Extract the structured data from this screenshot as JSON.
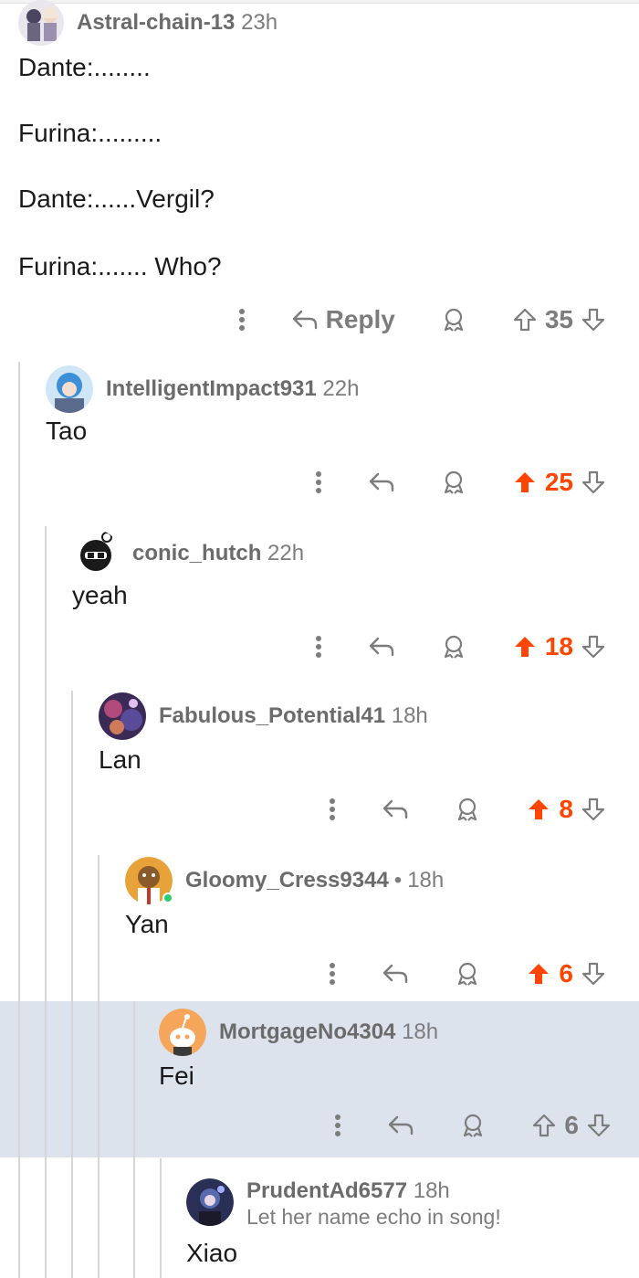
{
  "colors": {
    "upvote_active": "#ff4500",
    "muted": "#7c7c7c",
    "highlight_bg": "#dde3ec",
    "thread_line": "#d6d6d6"
  },
  "icons": [
    "more-vertical-icon",
    "reply-arrow-icon",
    "award-icon",
    "upvote-arrow-icon",
    "downvote-arrow-icon"
  ],
  "comments": [
    {
      "user": "Astral-chain-13",
      "time": "23h",
      "separator": "",
      "flair": "",
      "lines": [
        "Dante:........",
        "Furina:.........",
        "Dante:......Vergil?",
        "Furina:....... Who?"
      ],
      "reply_label": "Reply",
      "score": "35",
      "upvoted": false,
      "online": false,
      "highlighted": false
    },
    {
      "user": "IntelligentImpact931",
      "time": "22h",
      "separator": "",
      "flair": "",
      "lines": [
        "Tao"
      ],
      "reply_label": "",
      "score": "25",
      "upvoted": true,
      "online": false,
      "highlighted": false
    },
    {
      "user": "conic_hutch",
      "time": "22h",
      "separator": "",
      "flair": "",
      "lines": [
        "yeah"
      ],
      "reply_label": "",
      "score": "18",
      "upvoted": true,
      "online": false,
      "highlighted": false
    },
    {
      "user": "Fabulous_Potential41",
      "time": "18h",
      "separator": "",
      "flair": "",
      "lines": [
        "Lan"
      ],
      "reply_label": "",
      "score": "8",
      "upvoted": true,
      "online": false,
      "highlighted": false
    },
    {
      "user": "Gloomy_Cress9344",
      "time": "18h",
      "separator": "•",
      "flair": "",
      "lines": [
        "Yan"
      ],
      "reply_label": "",
      "score": "6",
      "upvoted": true,
      "online": true,
      "highlighted": false
    },
    {
      "user": "MortgageNo4304",
      "time": "18h",
      "separator": "",
      "flair": "",
      "lines": [
        "Fei"
      ],
      "reply_label": "",
      "score": "6",
      "upvoted": false,
      "online": false,
      "highlighted": true
    },
    {
      "user": "PrudentAd6577",
      "time": "18h",
      "separator": "",
      "flair": "Let her name echo in song!",
      "lines": [
        "Xiao"
      ],
      "reply_label": "",
      "score": "",
      "upvoted": false,
      "online": false,
      "highlighted": false
    }
  ]
}
